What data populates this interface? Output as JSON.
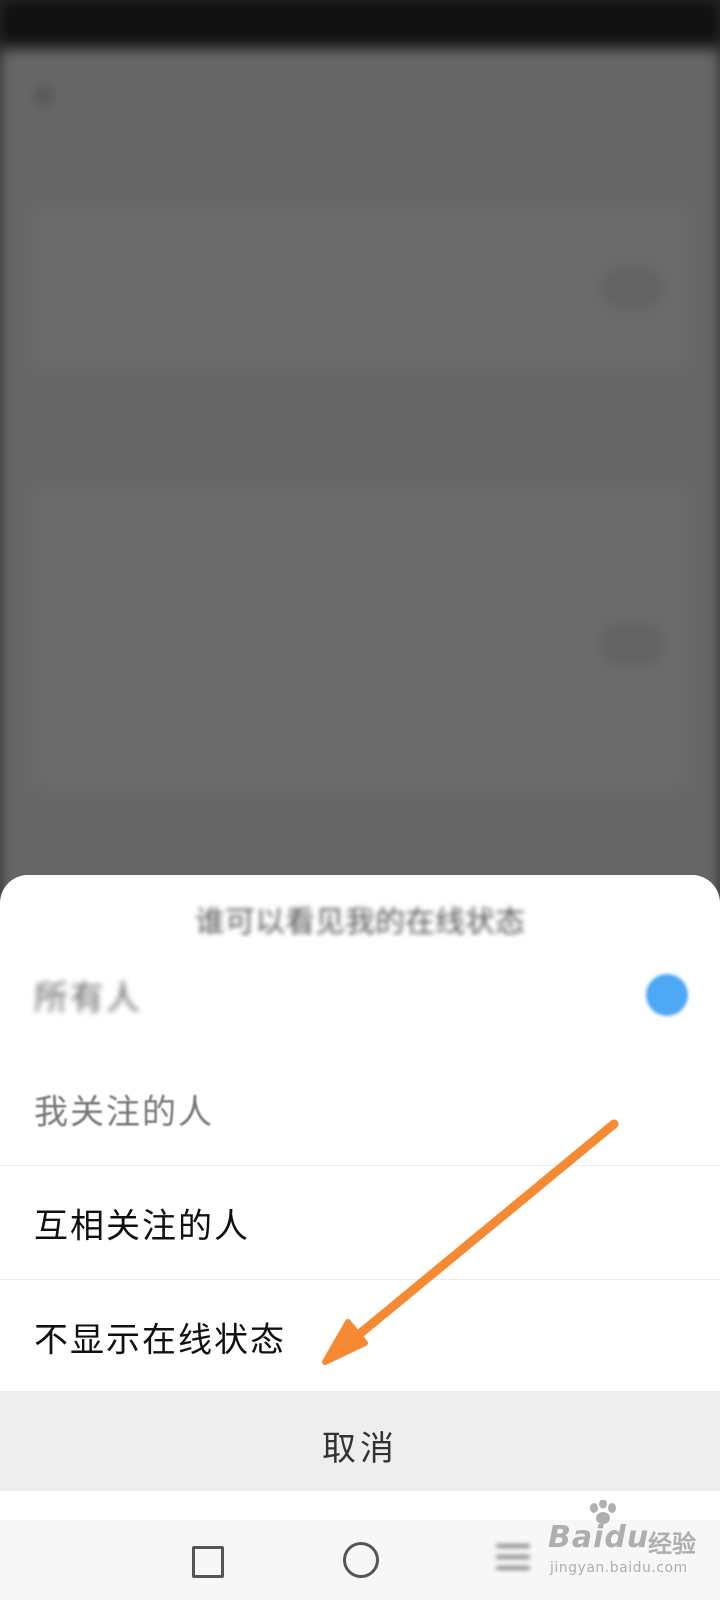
{
  "sheet": {
    "title": "谁可以看见我的在线状态",
    "options": [
      {
        "label": "所有人",
        "selected": true
      },
      {
        "label": "我关注的人",
        "selected": false
      },
      {
        "label": "互相关注的人",
        "selected": false
      },
      {
        "label": "不显示在线状态",
        "selected": false
      }
    ],
    "cancel_label": "取消"
  },
  "nav_bar": {
    "icons": [
      "recents-square-icon",
      "home-circle-icon",
      "menu-icon"
    ]
  },
  "watermark": {
    "brand": "Bai",
    "brand_tail": "du",
    "cn": "经验",
    "url": "jingyan.baidu.com"
  },
  "annotation": {
    "color": "#f58a32",
    "points_to": "不显示在线状态"
  },
  "colors": {
    "accent": "#4da8f5",
    "overlay": "rgba(0,0,0,0.58)"
  }
}
